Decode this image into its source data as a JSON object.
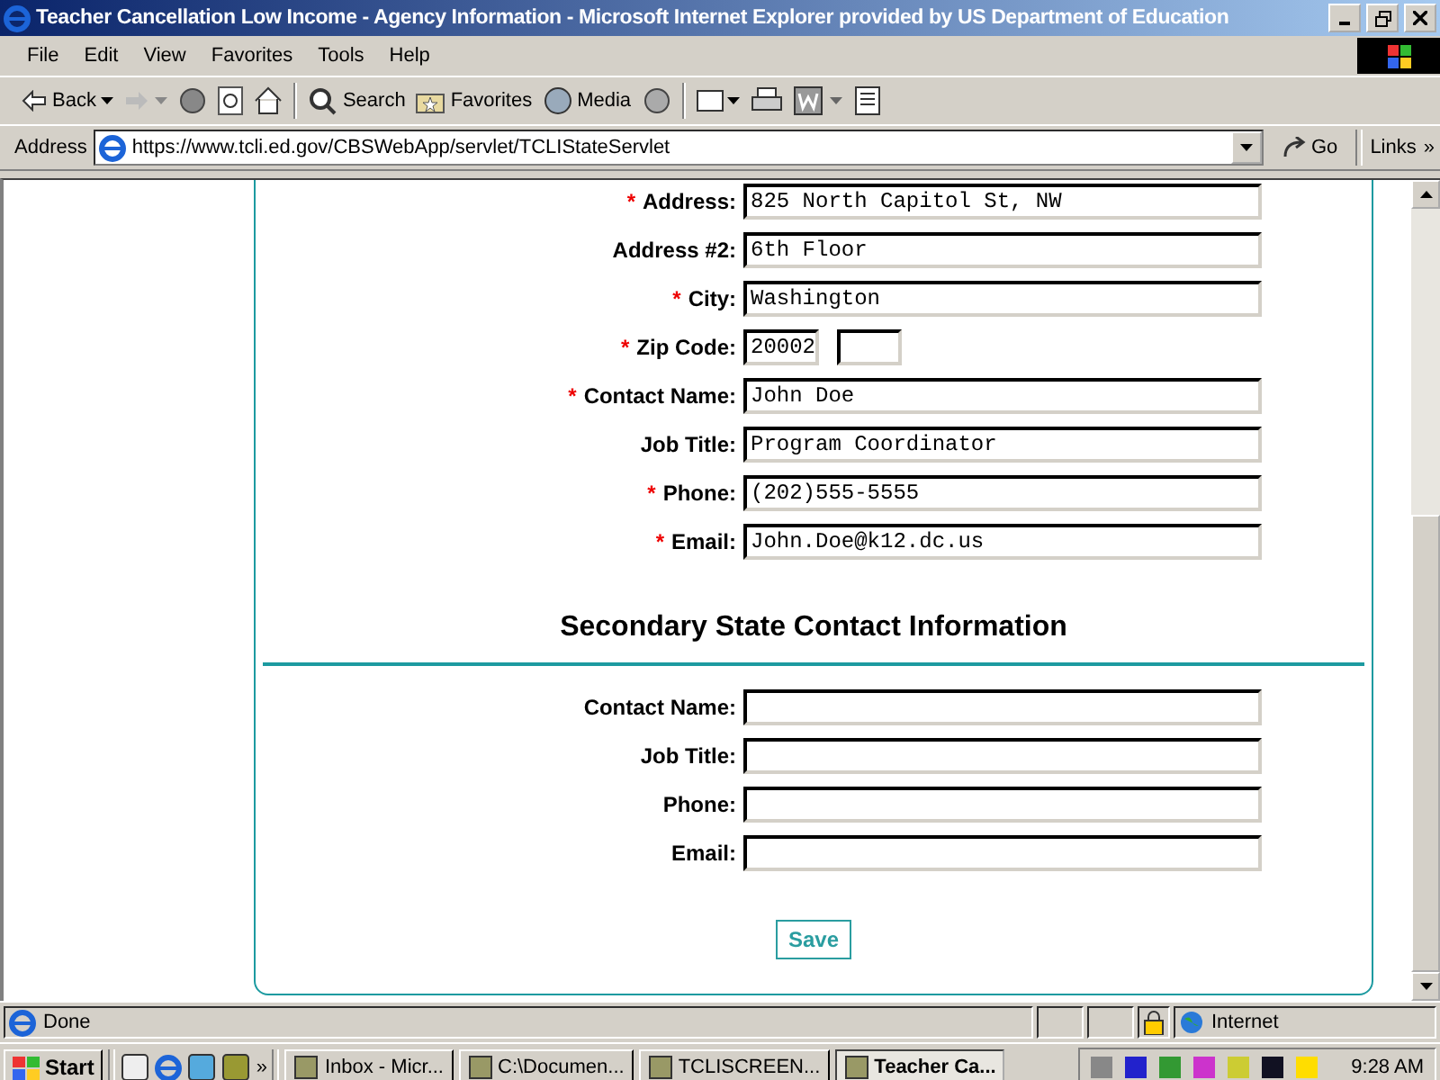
{
  "window": {
    "title": "Teacher Cancellation Low Income - Agency Information - Microsoft Internet Explorer provided by US Department of Education"
  },
  "menu": [
    "File",
    "Edit",
    "View",
    "Favorites",
    "Tools",
    "Help"
  ],
  "toolbar": {
    "back": "Back",
    "search": "Search",
    "favorites": "Favorites",
    "media": "Media"
  },
  "address": {
    "label": "Address",
    "url": "https://www.tcli.ed.gov/CBSWebApp/servlet/TCLIStateServlet",
    "go": "Go",
    "links": "Links",
    "more": "»"
  },
  "required_mark": "*",
  "primary_fields": [
    {
      "kind": "text",
      "label": "Address:",
      "required": true,
      "value": "825 North Capitol St, NW"
    },
    {
      "kind": "text",
      "label": "Address #2:",
      "required": false,
      "value": "6th Floor"
    },
    {
      "kind": "text",
      "label": "City:",
      "required": true,
      "value": "Washington"
    },
    {
      "kind": "zip",
      "label": "Zip Code:",
      "required": true,
      "value": "20002"
    },
    {
      "kind": "text",
      "label": "Contact Name:",
      "required": true,
      "value": "John Doe"
    },
    {
      "kind": "text",
      "label": "Job Title:",
      "required": false,
      "value": "Program Coordinator"
    },
    {
      "kind": "text",
      "label": "Phone:",
      "required": true,
      "value": "(202)555-5555"
    },
    {
      "kind": "text",
      "label": "Email:",
      "required": true,
      "value": "John.Doe@k12.dc.us"
    }
  ],
  "secondary": {
    "heading": "Secondary State Contact Information",
    "fields": [
      {
        "kind": "text",
        "label": "Contact Name:",
        "required": false
      },
      {
        "kind": "text",
        "label": "Job Title:",
        "required": false
      },
      {
        "kind": "text",
        "label": "Phone:",
        "required": false
      },
      {
        "kind": "text",
        "label": "Email:",
        "required": false
      }
    ]
  },
  "save": "Save",
  "status": {
    "text": "Done",
    "zone": "Internet"
  },
  "taskbar": {
    "start": "Start",
    "more": "»",
    "buttons": [
      {
        "label": "Inbox - Micr...",
        "selected": false
      },
      {
        "label": "C:\\Documen...",
        "selected": false
      },
      {
        "label": "TCLISCREEN...",
        "selected": false
      },
      {
        "label": "Teacher Ca...",
        "selected": true
      }
    ],
    "clock": "9:28 AM"
  }
}
